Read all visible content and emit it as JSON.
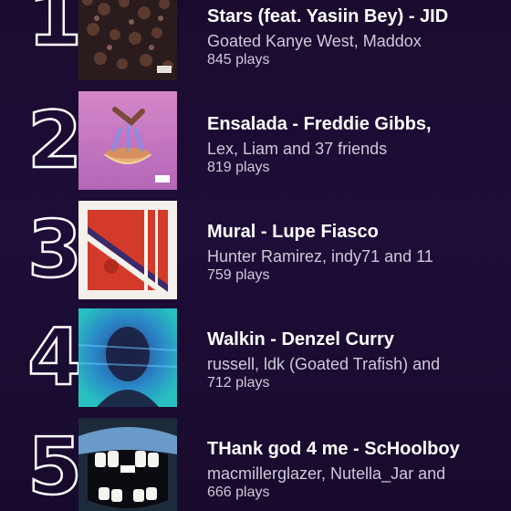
{
  "tracks": [
    {
      "rank": "1",
      "title": "Stars (feat. Yasiin Bey) - JID",
      "friends": "Goated Kanye West, Maddox",
      "plays": "845 plays",
      "art_icon": "crowd-album-art-icon"
    },
    {
      "rank": "2",
      "title": "Ensalada - Freddie Gibbs,",
      "friends": "Lex, Liam and 37 friends",
      "plays": "819 plays",
      "art_icon": "bowl-album-art-icon"
    },
    {
      "rank": "3",
      "title": "Mural - Lupe Fiasco",
      "friends": "Hunter Ramirez, indy71 and 11",
      "plays": "759 plays",
      "art_icon": "red-stripe-album-art-icon"
    },
    {
      "rank": "4",
      "title": "Walkin - Denzel Curry",
      "friends": "russell, ldk (Goated Trafish) and",
      "plays": "712 plays",
      "art_icon": "blurred-portrait-album-art-icon"
    },
    {
      "rank": "5",
      "title": "THank god 4 me - ScHoolboy",
      "friends": "macmillerglazer, Nutella_Jar and",
      "plays": "666 plays",
      "art_icon": "mouth-album-art-icon"
    }
  ],
  "colors": {
    "background": "#1e0d38",
    "text": "#ffffff",
    "subtext": "#cfc8da"
  }
}
